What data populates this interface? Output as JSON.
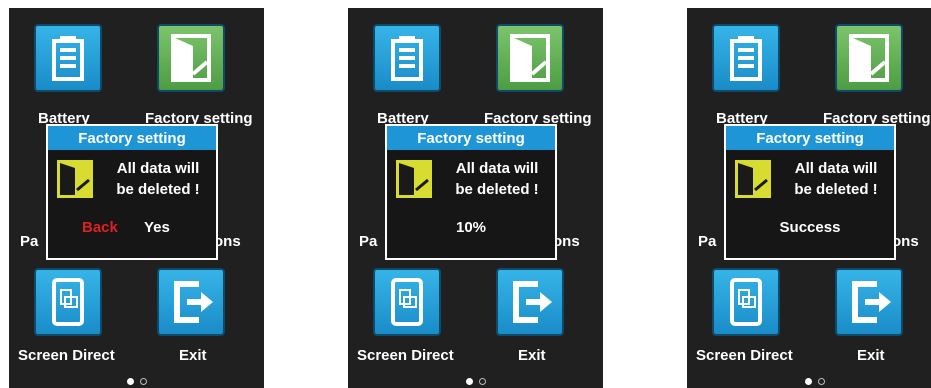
{
  "screens": [
    {
      "apps": {
        "battery": "Battery",
        "factory": "Factory setting",
        "partial_left": "Pa",
        "partial_right": "ons",
        "screen_direct": "Screen Direct",
        "exit": "Exit"
      },
      "dialog": {
        "title": "Factory setting",
        "line1": "All data will",
        "line2": "be deleted !",
        "back": "Back",
        "yes": "Yes"
      }
    },
    {
      "apps": {
        "battery": "Battery",
        "factory": "Factory setting",
        "partial_left": "Pa",
        "partial_right": "ons",
        "screen_direct": "Screen Direct",
        "exit": "Exit"
      },
      "dialog": {
        "title": "Factory setting",
        "line1": "All data will",
        "line2": "be deleted !",
        "status": "10%"
      }
    },
    {
      "apps": {
        "battery": "Battery",
        "factory": "Factory setting",
        "partial_left": "Pa",
        "partial_right": "ons",
        "screen_direct": "Screen Direct",
        "exit": "Exit"
      },
      "dialog": {
        "title": "Factory setting",
        "line1": "All data will",
        "line2": "be deleted !",
        "status": "Success"
      }
    }
  ],
  "colors": {
    "title_bar": "#1d95d7",
    "back": "#e02020",
    "screen_bg": "#202020"
  },
  "icons": [
    "battery-icon",
    "door-exit-icon",
    "screen-rotate-icon",
    "exit-arrow-icon"
  ],
  "pager": {
    "pages": 2,
    "current": 1
  }
}
